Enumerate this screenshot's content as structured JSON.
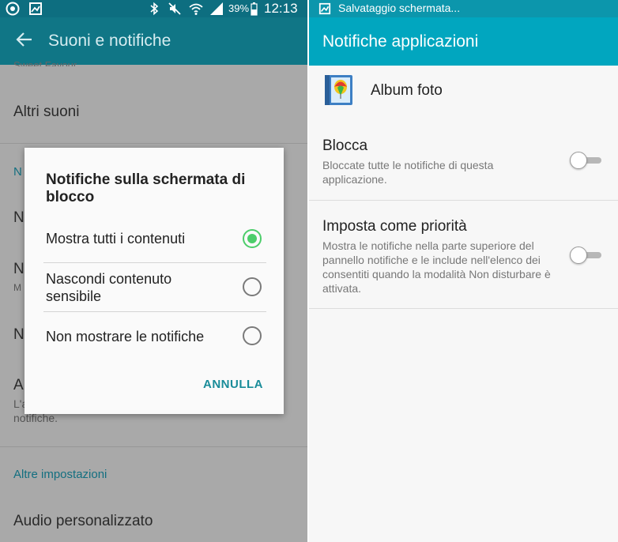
{
  "left_screen": {
    "status_bar": {
      "battery_percent": "39%",
      "time": "12:13"
    },
    "app_bar": {
      "title": "Suoni e notifiche"
    },
    "background_list": {
      "cut_top_text": "Sweet Favour",
      "row_altri_suoni": "Altri suoni",
      "hidden_row_initials": [
        "N",
        "N",
        "M",
        "N",
        "A",
        "L'a"
      ],
      "partial_subtext": "notifiche.",
      "section_altre_impostazioni": "Altre impostazioni",
      "row_audio_personalizzato": "Audio personalizzato"
    },
    "dialog": {
      "title": "Notifiche sulla schermata di blocco",
      "options": [
        {
          "label": "Mostra tutti i contenuti",
          "selected": true
        },
        {
          "label": "Nascondi contenuto sensibile",
          "selected": false
        },
        {
          "label": "Non mostrare le notifiche",
          "selected": false
        }
      ],
      "cancel_label": "ANNULLA"
    }
  },
  "right_screen": {
    "status_bar": {
      "notification_text": "Salvataggio schermata..."
    },
    "app_bar": {
      "title": "Notifiche applicazioni"
    },
    "app": {
      "name": "Album foto"
    },
    "settings": [
      {
        "title": "Blocca",
        "description": "Bloccate tutte le notifiche di questa applicazione.",
        "enabled": false
      },
      {
        "title": "Imposta come priorità",
        "description": "Mostra le notifiche nella parte superiore del pannello notifiche e le include nell'elenco dei consentiti quando la modalità Non disturbare è attivata.",
        "enabled": false
      }
    ]
  },
  "colors": {
    "left_app_bar": "#107686",
    "right_app_bar": "#01a6bf",
    "radio_selected": "#4ccd6a",
    "accent_text": "#198c99",
    "scrim_background": "#a9a9a9"
  }
}
